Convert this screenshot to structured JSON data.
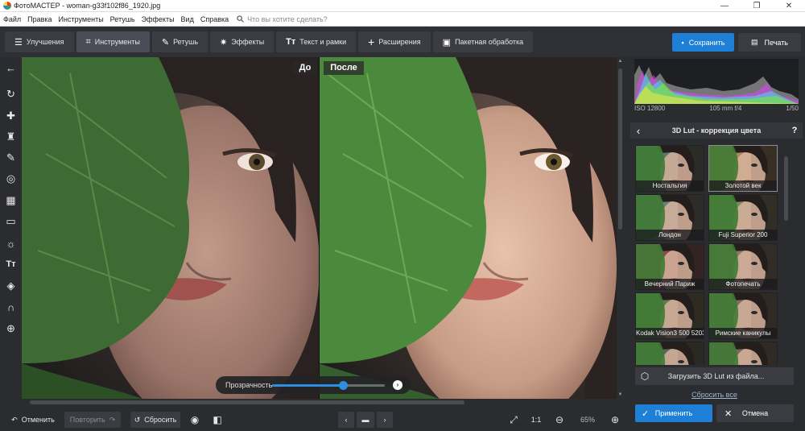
{
  "window": {
    "title": "ФотоМАСТЕР - woman-g33f102f86_1920.jpg",
    "controls": [
      "—",
      "❐",
      "✕"
    ]
  },
  "menu": {
    "items": [
      "Файл",
      "Правка",
      "Инструменты",
      "Ретушь",
      "Эффекты",
      "Вид",
      "Справка"
    ],
    "search_placeholder": "Что вы хотите сделать?"
  },
  "toolbar": {
    "tabs": [
      {
        "label": "Улучшения",
        "icon": "sliders-icon",
        "active": false
      },
      {
        "label": "Инструменты",
        "icon": "crop-icon",
        "active": true
      },
      {
        "label": "Ретушь",
        "icon": "brush-icon",
        "active": false
      },
      {
        "label": "Эффекты",
        "icon": "sparkle-icon",
        "active": false
      },
      {
        "label": "Текст и рамки",
        "icon": "text-icon",
        "active": false
      },
      {
        "label": "Расширения",
        "icon": "plus-icon",
        "active": false
      },
      {
        "label": "Пакетная обработка",
        "icon": "batch-icon",
        "active": false
      }
    ],
    "save_label": "Сохранить",
    "print_label": "Печать"
  },
  "left_tools": [
    "back-arrow-icon",
    "rotate-icon",
    "patch-icon",
    "stamp-icon",
    "brush-icon",
    "radial-icon",
    "gradient-icon",
    "vignette-icon",
    "light-icon",
    "text-icon",
    "fill-icon",
    "magnet-icon",
    "globe-icon"
  ],
  "canvas": {
    "before_label": "До",
    "after_label": "После",
    "opacity_label": "Прозрачность",
    "opacity_value": 0.63
  },
  "bottom": {
    "undo_label": "Отменить",
    "redo_label": "Повторить",
    "reset_label": "Сбросить",
    "ratio_label": "1:1",
    "zoom_label": "65%"
  },
  "right_panel": {
    "exif": {
      "iso": "ISO 12800",
      "lens": "105 mm f/4",
      "shutter": "1/50"
    },
    "section_title": "3D Lut - коррекция цвета",
    "luts": [
      {
        "name": "Ностальгия",
        "tint": "#5a7a6a",
        "selected": false
      },
      {
        "name": "Золотой век",
        "tint": "#a88a5a",
        "selected": true
      },
      {
        "name": "Лондон",
        "tint": "#6a7f80",
        "selected": false
      },
      {
        "name": "Fuji Superior 200",
        "tint": "#7a8a60",
        "selected": false
      },
      {
        "name": "Вечерний Париж",
        "tint": "#8a4a50",
        "selected": false
      },
      {
        "name": "Фотопечать",
        "tint": "#8a7a66",
        "selected": false
      },
      {
        "name": "Kodak Vision3 500 5203",
        "tint": "#6a7a50",
        "selected": false
      },
      {
        "name": "Римские каникулы",
        "tint": "#7a7060",
        "selected": false
      },
      {
        "name": "",
        "tint": "#5a6a5a",
        "selected": false
      },
      {
        "name": "",
        "tint": "#7a6a5a",
        "selected": false
      }
    ],
    "load_label": "Загрузить 3D Lut из файла...",
    "reset_all_label": "Сбросить все",
    "apply_label": "Применить",
    "cancel_label": "Отмена"
  }
}
